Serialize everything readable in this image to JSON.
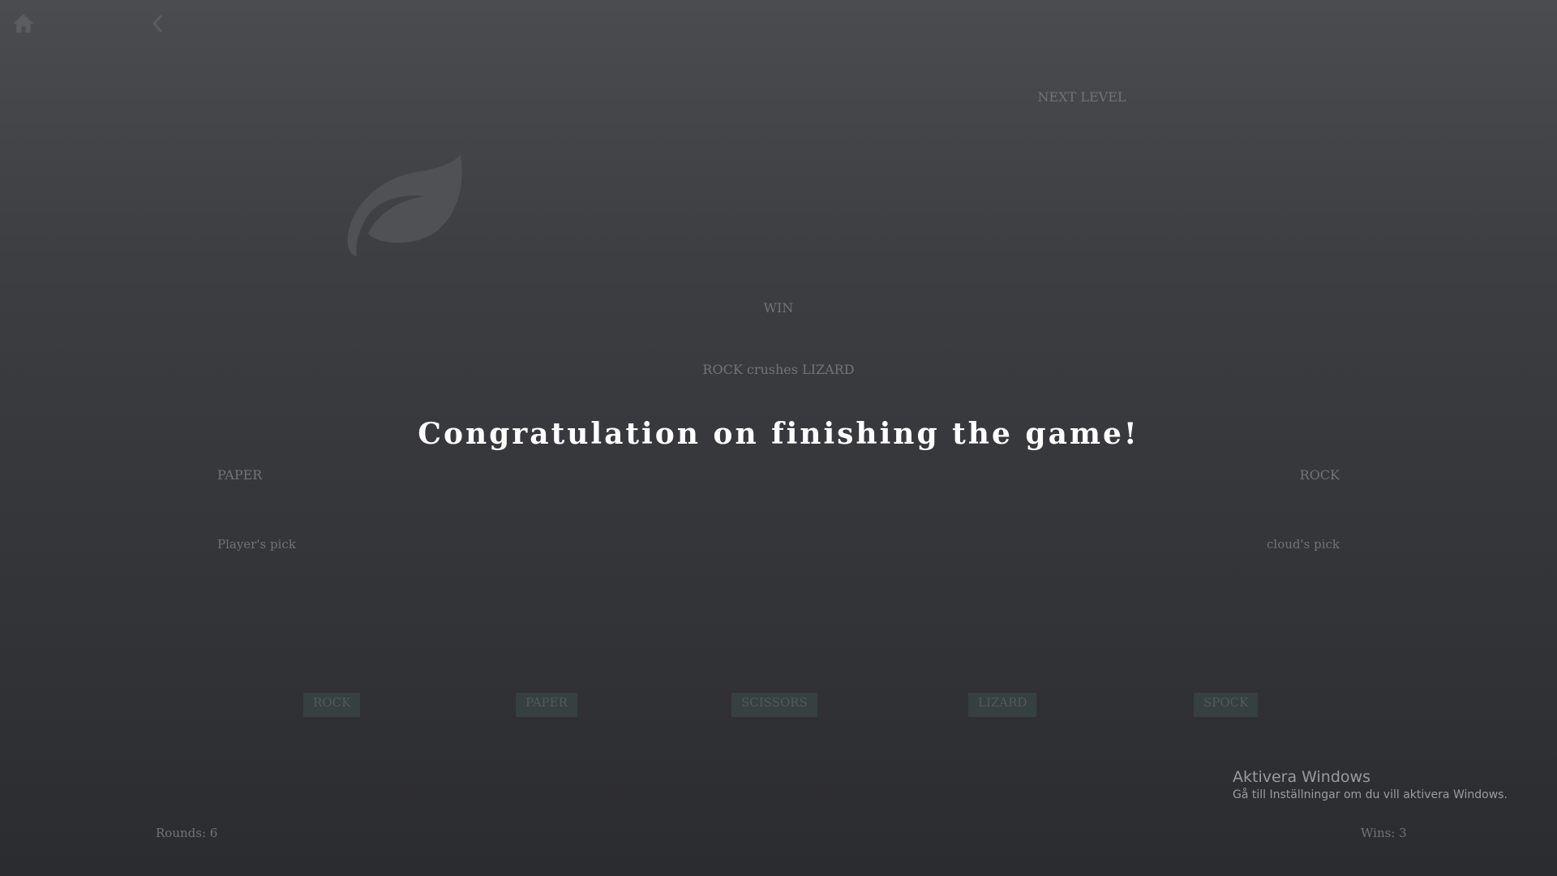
{
  "nav": {
    "home_icon": "home-icon",
    "back_icon": "chevron-left-icon"
  },
  "header": {
    "next_level": "NEXT LEVEL"
  },
  "round": {
    "pick_icon": "leaf-icon",
    "result": "WIN",
    "explanation": "ROCK crushes LIZARD"
  },
  "overlay": {
    "message": "Congratulation on finishing the game!"
  },
  "player": {
    "choice": "PAPER",
    "label": "Player's pick"
  },
  "cloud": {
    "choice": "ROCK",
    "label": "cloud's pick"
  },
  "choices": [
    "ROCK",
    "PAPER",
    "SCISSORS",
    "LIZARD",
    "SPOCK"
  ],
  "stats": {
    "rounds": "Rounds: 6",
    "wins": "Wins: 3"
  },
  "windows_watermark": {
    "title": "Aktivera Windows",
    "subtitle": "Gå till Inställningar om du vill aktivera Windows."
  },
  "colors": {
    "background_top": "#4b4c4f",
    "background_bottom": "#2b2c2f",
    "message_text": "#ffffff",
    "muted_text": "#727376",
    "button_bg": "#36403f"
  }
}
